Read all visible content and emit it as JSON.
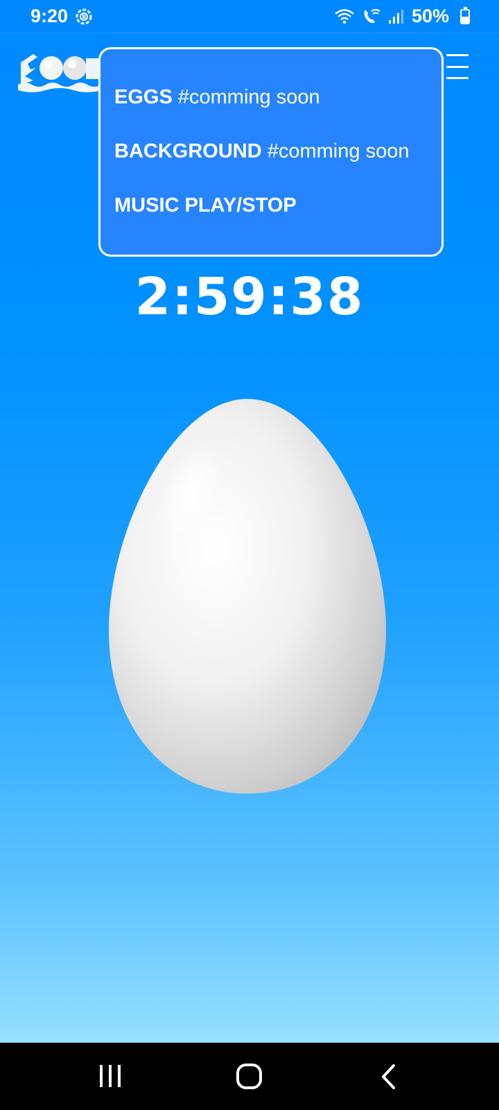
{
  "status_bar": {
    "time": "9:20",
    "battery_percent": "50%",
    "battery_level": 0.5,
    "icons": [
      "sync-icon",
      "wifi-icon",
      "wifi-calling-icon",
      "signal-icon",
      "battery-icon"
    ]
  },
  "header": {
    "logo_icon": "eggs-logo-icon",
    "menu_icon": "hamburger-menu-icon"
  },
  "menu": {
    "items": [
      {
        "label": "EGGS",
        "note": "#comming soon"
      },
      {
        "label": "BACKGROUND",
        "note": "#comming soon"
      },
      {
        "label": "MUSIC PLAY/STOP",
        "note": ""
      }
    ]
  },
  "timer": {
    "value": "2:59:38"
  },
  "egg": {
    "icon": "egg-image"
  },
  "nav_bar": {
    "icons": [
      "recent-apps-icon",
      "home-icon",
      "back-icon"
    ]
  },
  "colors": {
    "background_top": "#0089ff",
    "background_bottom": "#aeecff",
    "menu_background": "#2784ff",
    "text": "#ffffff"
  }
}
